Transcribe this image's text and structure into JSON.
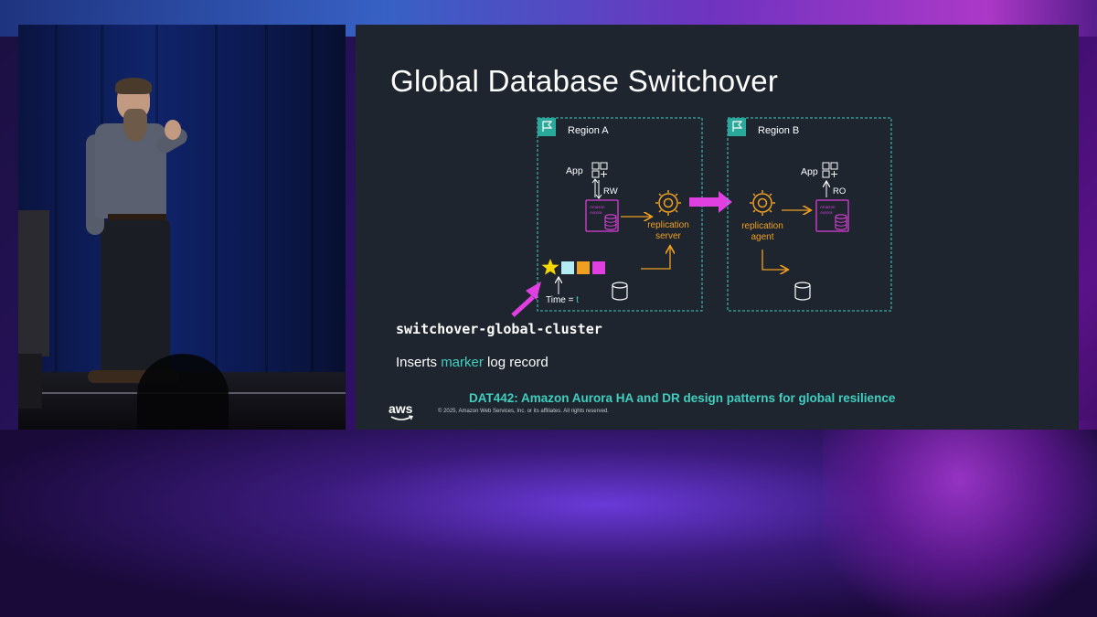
{
  "slide": {
    "title": "Global Database Switchover",
    "command": "switchover-global-cluster",
    "inserts": {
      "prefix": "Inserts ",
      "highlight": "marker",
      "suffix": " log record"
    },
    "session": "DAT442: Amazon Aurora HA and DR design patterns for global resilience",
    "copyright": "© 2025, Amazon Web Services, Inc. or its affiliates. All rights reserved.",
    "logo_text": "aws"
  },
  "diagram": {
    "region_a": {
      "label": "Region A",
      "app_label": "App",
      "access_label": "RW",
      "db_label_1": "Amazon",
      "db_label_2": "Aurora",
      "server_label_1": "replication",
      "server_label_2": "server"
    },
    "region_b": {
      "label": "Region B",
      "app_label": "App",
      "access_label": "RO",
      "db_label_1": "Amazon",
      "db_label_2": "Aurora",
      "agent_label_1": "replication",
      "agent_label_2": "agent"
    },
    "time_label": "Time = ",
    "time_var": "t",
    "log_colors": [
      "#b3ecf2",
      "#f0a020",
      "#e040e0"
    ],
    "colors": {
      "teal": "#3fcfc0",
      "magenta": "#d93ed8",
      "orange": "#f0a020",
      "star": "#f5d800"
    }
  }
}
